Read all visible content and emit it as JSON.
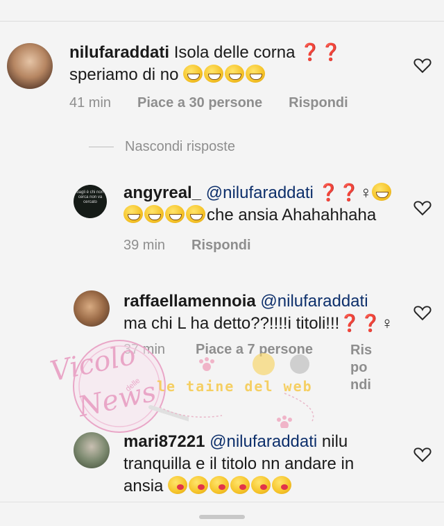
{
  "comments": [
    {
      "username": "nilufaraddati",
      "text_line1": "Isola delle corna ❓❓",
      "text_line2": "speriamo di no",
      "time": "41 min",
      "likes": "Piace a 30 persone",
      "reply": "Rispondi"
    },
    {
      "username": "angyreal_",
      "mention": "@nilufaraddati",
      "text_line1_suffix": "❓❓♀",
      "text_line2": "che ansia Ahahahhaha",
      "time": "39 min",
      "reply": "Rispondi",
      "avatar_text": "Sbagli è chi non ti cerca non va cercato"
    },
    {
      "username": "raffaellamennoia",
      "mention": "@nilufaraddati",
      "text_line2": "ma chi L ha detto??!!!!i titoli!!!❓❓♀",
      "time": "37 min",
      "likes": "Piace a 7 persone",
      "reply_lines": [
        "Ris",
        "po",
        "ndi"
      ]
    },
    {
      "username": "mari87221",
      "mention": "@nilufaraddati",
      "text_line1_suffix": "nilu",
      "text_line2": "tranquilla e il titolo nn andare in",
      "text_line3": "ansia"
    }
  ],
  "hide_replies": "Nascondi risposte",
  "watermarks": {
    "vicolo": "Vicolo",
    "delle": "delle",
    "news": "News",
    "taine": "le taine del web"
  },
  "colors": {
    "background": "#f4f4f4",
    "meta_text": "#8e8e8e",
    "mention": "#0d2f6b",
    "watermark_pink": "#e9a6c7",
    "watermark_yellow": "#f6c94a"
  },
  "icons": [
    "heart-icon",
    "laugh-emoji-icon",
    "kiss-emoji-icon",
    "paw-icon"
  ]
}
